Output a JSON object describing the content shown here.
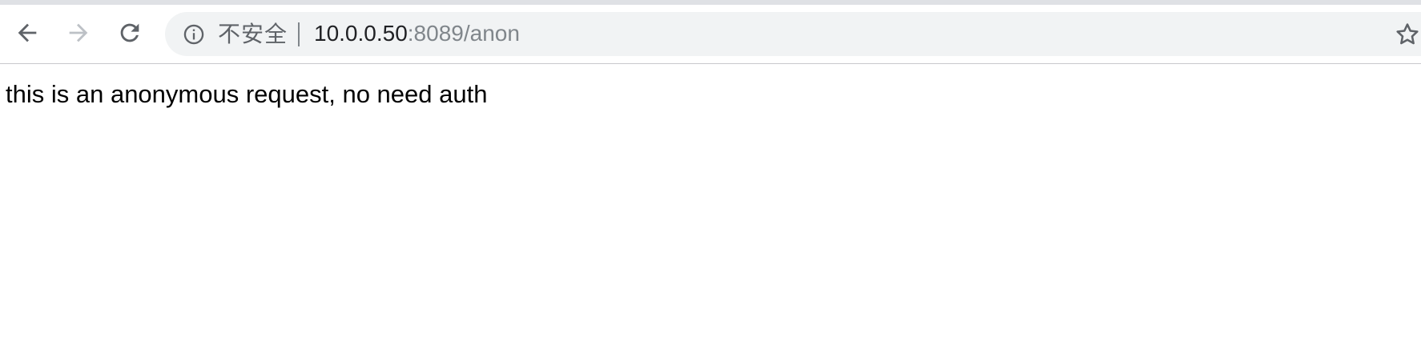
{
  "browser": {
    "address_bar": {
      "security_label": "不安全",
      "url_host": "10.0.0.50",
      "url_rest": ":8089/anon"
    },
    "icons": {
      "back": "arrow-left-icon",
      "forward": "arrow-right-icon",
      "reload": "reload-icon",
      "info": "info-icon",
      "bookmark": "star-icon"
    }
  },
  "page": {
    "body_text": "this is an anonymous request, no need auth"
  },
  "colors": {
    "toolbar_strip": "#dfe1e5",
    "omnibox_bg": "#f1f3f4",
    "icon_active": "#5f6368",
    "icon_disabled": "#bdc1c6",
    "url_host": "#202124",
    "url_rest": "#80868b"
  }
}
